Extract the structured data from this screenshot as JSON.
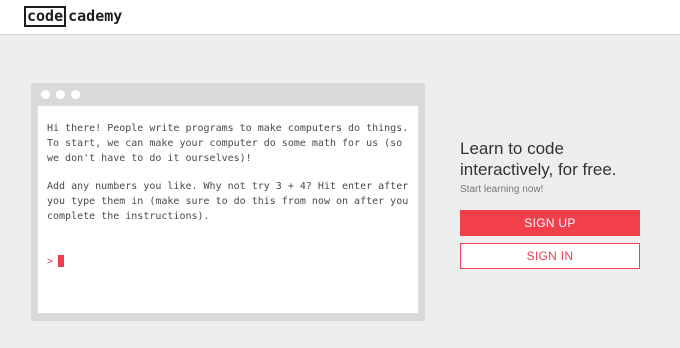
{
  "header": {
    "logo_part1": "code",
    "logo_part2": "cademy"
  },
  "terminal": {
    "paragraph1": "Hi there! People write programs to make computers do things. To start, we can make your computer do some math for us (so we don't have to do it ourselves)!",
    "paragraph2": "Add any numbers you like. Why not try 3 + 4? Hit enter after you type them in (make sure to do this from now on after you complete the instructions).",
    "prompt": ">"
  },
  "cta": {
    "headline": "Learn to code interactively, for free.",
    "subline": "Start learning now!",
    "signup_label": "SIGN UP",
    "signin_label": "SIGN IN"
  },
  "colors": {
    "accent": "#f1404b",
    "background": "#eeeeee",
    "terminal_frame": "#d9d9d9"
  },
  "icons": [
    "window-dot-icon",
    "window-dot-icon",
    "window-dot-icon"
  ]
}
